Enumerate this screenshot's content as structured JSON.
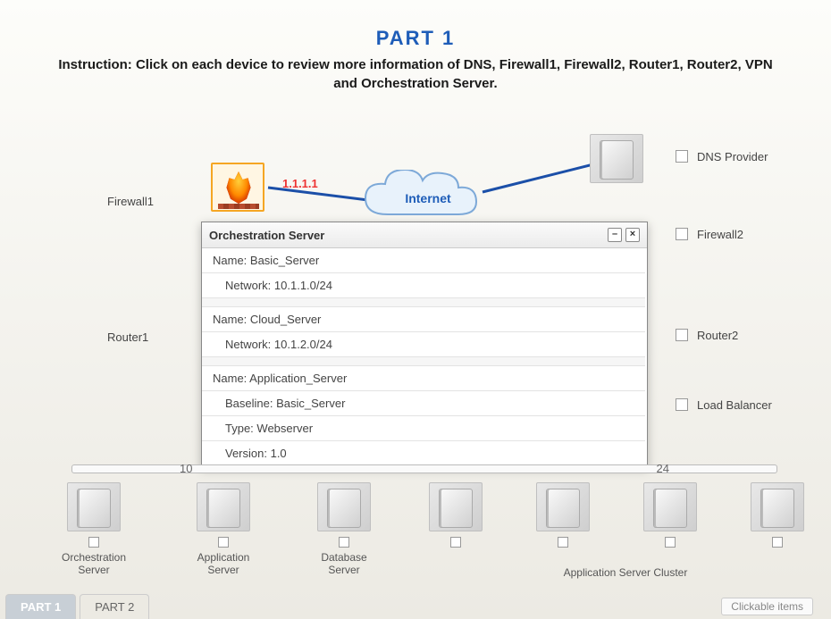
{
  "header": {
    "part_title": "PART 1",
    "instruction": "Instruction: Click on each device to review more information of DNS, Firewall1, Firewall2, Router1, Router2, VPN and Orchestration Server."
  },
  "top": {
    "firewall1_label": "Firewall1",
    "firewall1_ip": "1.1.1.1",
    "internet_label": "Internet",
    "dns_label": "DNS Provider",
    "firewall2_label": "Firewall2"
  },
  "mid": {
    "router1_label": "Router1",
    "router2_label": "Router2",
    "load_balancer_label": "Load Balancer"
  },
  "bus": {
    "left_ip_fragment": "10",
    "right_ip_fragment": "24"
  },
  "bottom_nodes": {
    "orchestration": "Orchestration Server",
    "application": "Application Server",
    "database": "Database Server",
    "cluster_label": "Application Server Cluster"
  },
  "popup": {
    "title": "Orchestration Server",
    "sections": [
      {
        "name": "Name: Basic_Server",
        "rows": [
          "Network: 10.1.1.0/24"
        ]
      },
      {
        "name": "Name: Cloud_Server",
        "rows": [
          "Network: 10.1.2.0/24"
        ]
      },
      {
        "name": "Name: Application_Server",
        "rows": [
          "Baseline: Basic_Server",
          "Type: Webserver",
          "Version: 1.0"
        ]
      }
    ]
  },
  "tabs": {
    "part1": "PART 1",
    "part2": "PART 2",
    "clickable": "Clickable items"
  }
}
